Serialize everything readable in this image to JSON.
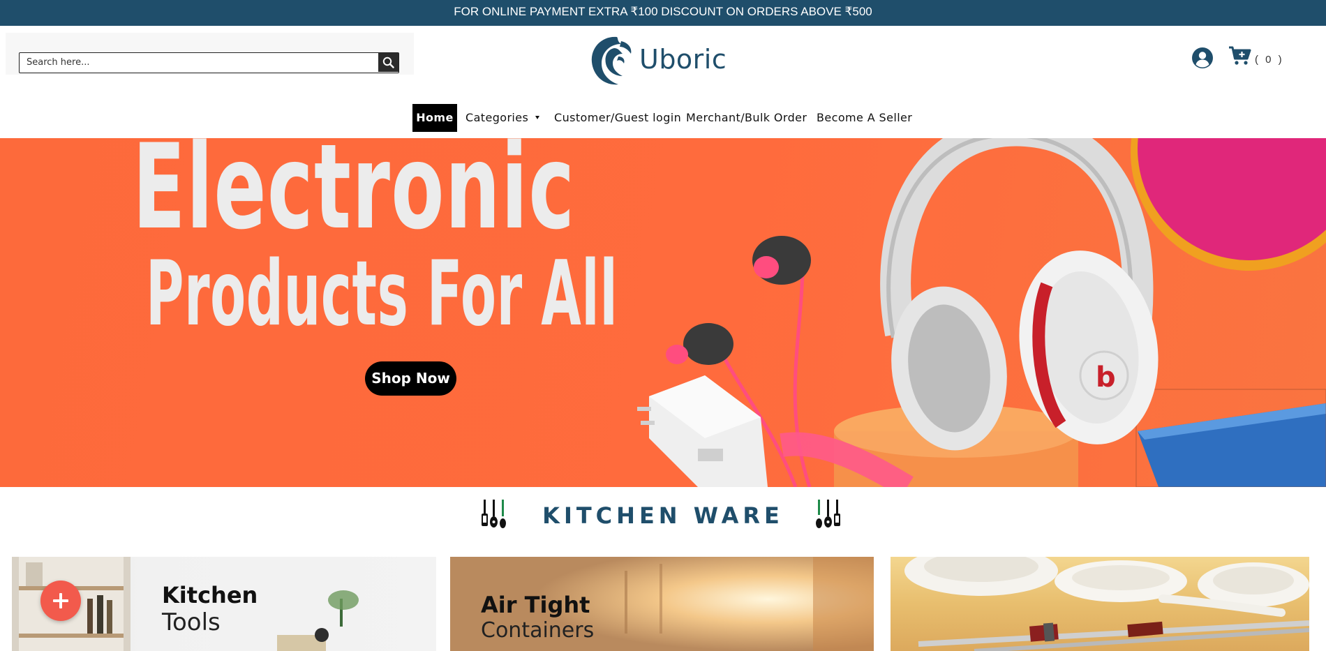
{
  "announcement": {
    "text": "FOR ONLINE PAYMENT EXTRA ₹100 DISCOUNT ON ORDERS ABOVE ₹500"
  },
  "header": {
    "search_placeholder": "Search here...",
    "brand": "Uboric",
    "cart_count": "( 0 )"
  },
  "nav": {
    "items": [
      {
        "label": "Home",
        "active": true
      },
      {
        "label": "Categories",
        "has_dropdown": true
      },
      {
        "label": "Customer/Guest login"
      },
      {
        "label": "Merchant/Bulk Order"
      },
      {
        "label": "Become A Seller"
      }
    ]
  },
  "hero": {
    "line1": "Electronic",
    "line2": "Products For All",
    "cta": "Shop Now"
  },
  "section": {
    "title": "KITCHEN WARE"
  },
  "categories": [
    {
      "title": "Kitchen",
      "subtitle": "Tools"
    },
    {
      "title": "Air Tight",
      "subtitle": "Containers"
    },
    {
      "title": "",
      "subtitle": ""
    }
  ],
  "colors": {
    "brand": "#1f4e6b",
    "hero_bg": "#ff6b3d",
    "fab": "#f25a4c"
  },
  "icons": {
    "search": "search-icon",
    "user": "user-circle-icon",
    "cart": "cart-plus-icon",
    "fab": "plus-icon",
    "kitchen": "kitchen-utensils-icon"
  }
}
